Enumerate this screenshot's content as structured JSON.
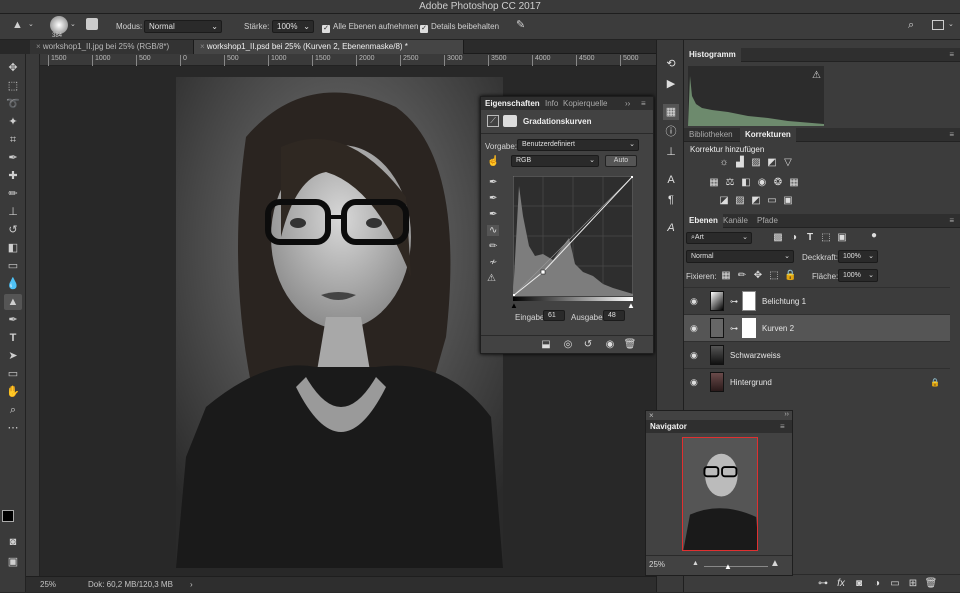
{
  "app": {
    "title": "Adobe Photoshop CC 2017"
  },
  "options": {
    "brush_size": "384",
    "mode_label": "Modus:",
    "mode_value": "Normal",
    "strength_label": "Stärke:",
    "strength_value": "100%",
    "all_layers_label": "Alle Ebenen aufnehmen",
    "details_label": "Details beibehalten"
  },
  "tabs": [
    {
      "label": "workshop1_II.jpg bei 25% (RGB/8*)"
    },
    {
      "label": "workshop1_II.psd bei 25% (Kurven 2, Ebenenmaske/8) *"
    }
  ],
  "ruler": {
    "ticks": [
      "1500",
      "1000",
      "500",
      "0",
      "500",
      "1000",
      "1500",
      "2000",
      "2500",
      "3000",
      "3500",
      "4000",
      "4500",
      "5000"
    ]
  },
  "status": {
    "zoom": "25%",
    "doc": "Dok: 60,2 MB/120,3 MB",
    "arrow": "›"
  },
  "histogram": {
    "title": "Histogramm",
    "warning": "⚠"
  },
  "adjustments": {
    "tabs": [
      "Bibliotheken",
      "Korrekturen"
    ],
    "heading": "Korrektur hinzufügen"
  },
  "layers": {
    "tabs": [
      "Ebenen",
      "Kanäle",
      "Pfade"
    ],
    "filter_value": "Art",
    "blend_value": "Normal",
    "opacity_label": "Deckkraft:",
    "opacity_value": "100%",
    "lock_label": "Fixieren:",
    "fill_label": "Fläche:",
    "fill_value": "100%",
    "items": [
      {
        "name": "Belichtung 1"
      },
      {
        "name": "Kurven 2"
      },
      {
        "name": "Schwarzweiss"
      },
      {
        "name": "Hintergrund"
      }
    ]
  },
  "properties": {
    "tabs": [
      "Eigenschaften",
      "Info",
      "Kopierquelle"
    ],
    "title": "Gradationskurven",
    "preset_label": "Vorgabe:",
    "preset_value": "Benutzerdefiniert",
    "channel_value": "RGB",
    "auto_label": "Auto",
    "input_label": "Eingabe:",
    "input_value": "61",
    "output_label": "Ausgabe:",
    "output_value": "48"
  },
  "navigator": {
    "title": "Navigator",
    "zoom": "25%"
  },
  "colors": {
    "bg": "#282828",
    "panel": "#3c3c3c",
    "selected_layer": "#555555",
    "navigator_frame": "#e03030"
  }
}
